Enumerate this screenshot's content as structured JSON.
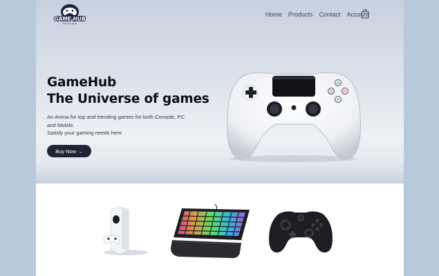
{
  "brand": {
    "logo_text": "GAME HUB",
    "logo_tagline": "play your game"
  },
  "nav": {
    "items": [
      "Home",
      "Products",
      "Contact",
      "Account"
    ]
  },
  "hero": {
    "title": "GameHub\nThe Universe of games",
    "description": "An Arena for top and trending games for both Console, PC\nand Mobile.\nSatisfy your gaming needs here",
    "cta_label": "Buy Now →"
  },
  "products": [
    {
      "icon": "console-icon"
    },
    {
      "icon": "keyboard-icon"
    },
    {
      "icon": "controller-icon"
    }
  ],
  "colors": {
    "accent": "#1e2435",
    "background": "#b9c9dc"
  }
}
